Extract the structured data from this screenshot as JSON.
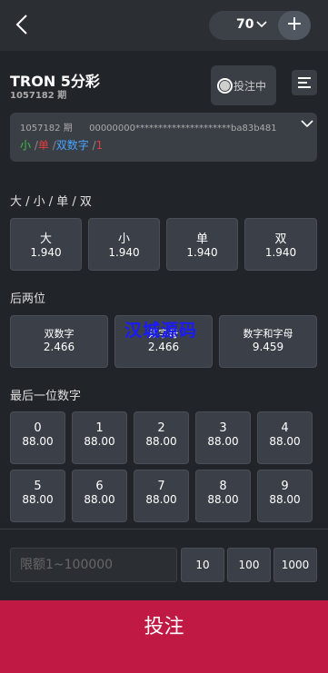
{
  "header": {
    "chip_value": "70",
    "add_label": "+"
  },
  "game": {
    "title": "TRON 5分彩",
    "period": "1057182 期"
  },
  "bet_status": "投注中",
  "info": {
    "period": "1057182 期",
    "hash": "00000000*********************ba83b481",
    "results": [
      {
        "text": "小",
        "color": "#3fbf3f"
      },
      {
        "text": " /",
        "color": "#888888"
      },
      {
        "text": "单",
        "color": "#e03c3c"
      },
      {
        "text": " /",
        "color": "#888888"
      },
      {
        "text": "双数字",
        "color": "#4aa3ff"
      },
      {
        "text": " /",
        "color": "#888888"
      },
      {
        "text": "1",
        "color": "#e03c3c"
      }
    ]
  },
  "sections": {
    "size_parity": {
      "label": "大 / 小 / 单 / 双",
      "options": [
        {
          "name": "大",
          "odds": "1.940"
        },
        {
          "name": "小",
          "odds": "1.940"
        },
        {
          "name": "单",
          "odds": "1.940"
        },
        {
          "name": "双",
          "odds": "1.940"
        }
      ]
    },
    "last_two": {
      "label": "后两位",
      "options": [
        {
          "name": "双数字",
          "odds": "2.466"
        },
        {
          "name": "双字母",
          "odds": "2.466"
        },
        {
          "name": "数字和字母",
          "odds": "9.459"
        }
      ]
    },
    "last_digit": {
      "label": "最后一位数字",
      "options": [
        {
          "name": "0",
          "odds": "88.00"
        },
        {
          "name": "1",
          "odds": "88.00"
        },
        {
          "name": "2",
          "odds": "88.00"
        },
        {
          "name": "3",
          "odds": "88.00"
        },
        {
          "name": "4",
          "odds": "88.00"
        },
        {
          "name": "5",
          "odds": "88.00"
        },
        {
          "name": "6",
          "odds": "88.00"
        },
        {
          "name": "7",
          "odds": "88.00"
        },
        {
          "name": "8",
          "odds": "88.00"
        },
        {
          "name": "9",
          "odds": "88.00"
        }
      ]
    }
  },
  "watermark": "汉城源码",
  "bet_input": {
    "placeholder": "限额1~100000"
  },
  "quick_amounts": [
    "10",
    "100",
    "1000"
  ],
  "submit_label": "投注",
  "colors": {
    "background": "#212429",
    "panel": "#3b4048",
    "submit": "#c01a44"
  }
}
